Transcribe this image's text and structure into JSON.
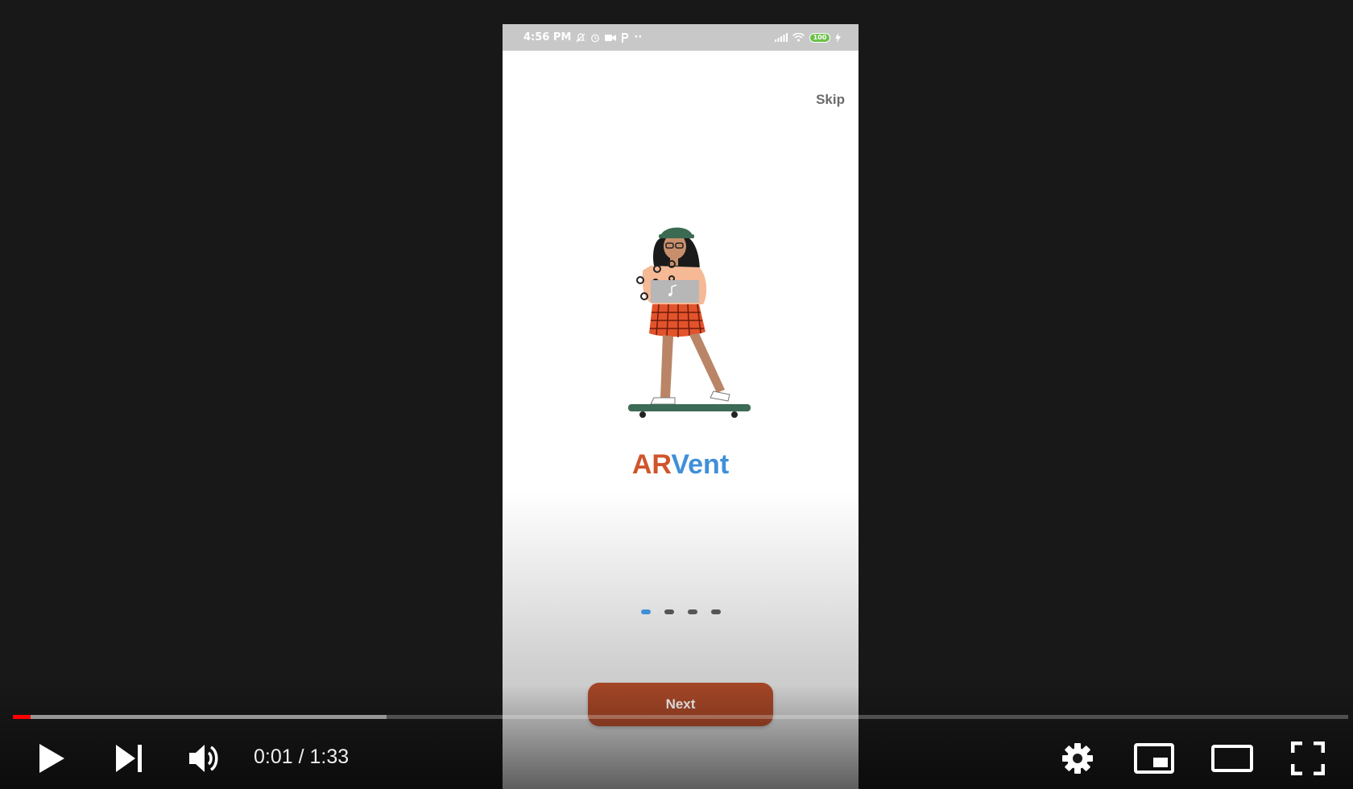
{
  "status_bar": {
    "time": "4:56 PM",
    "battery": "100",
    "dots": "··"
  },
  "onboarding": {
    "skip_label": "Skip",
    "brand_part1": "AR",
    "brand_part2": "Vent",
    "page_count": 4,
    "active_page": 1,
    "next_label": "Next"
  },
  "player": {
    "current_time": "0:01",
    "separator": " / ",
    "duration": "1:33",
    "played_fraction": 0.013,
    "loaded_fraction": 0.28,
    "icons": [
      "play-icon",
      "next-video-icon",
      "volume-icon",
      "settings-icon",
      "miniplayer-icon",
      "theater-mode-icon",
      "fullscreen-icon"
    ]
  },
  "colors": {
    "accent_ar": "#d0552a",
    "accent_vent": "#3f8fd9",
    "next_button": "#a24526",
    "progress_played": "#ff0000"
  }
}
